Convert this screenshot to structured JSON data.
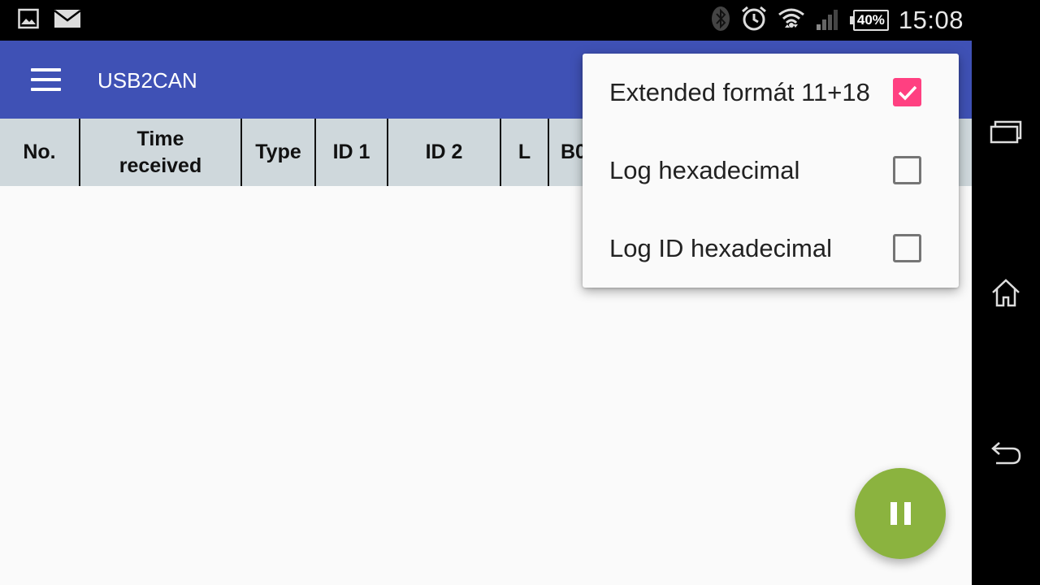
{
  "status_bar": {
    "time": "15:08",
    "battery": "40%",
    "left_icons": [
      "image-icon",
      "mail-icon"
    ],
    "right_icons": [
      "bluetooth-icon",
      "alarm-icon",
      "wifi-icon",
      "signal-icon",
      "battery-icon"
    ]
  },
  "toolbar": {
    "title": "USB2CAN",
    "color": "#3f51b5"
  },
  "table": {
    "columns": [
      "No.",
      "Time received",
      "Type",
      "ID 1",
      "ID 2",
      "L",
      "B0"
    ],
    "header_color": "#cfd8dc"
  },
  "menu": {
    "items": [
      {
        "label": "Extended formát 11+18",
        "checked": true
      },
      {
        "label": "Log hexadecimal",
        "checked": false
      },
      {
        "label": "Log ID hexadecimal",
        "checked": false
      }
    ],
    "accent_color": "#ff4081"
  },
  "fab": {
    "icon": "pause-icon",
    "color": "#8bb33f"
  },
  "nav_bar": {
    "icons": [
      "recents-icon",
      "home-icon",
      "back-icon"
    ]
  }
}
